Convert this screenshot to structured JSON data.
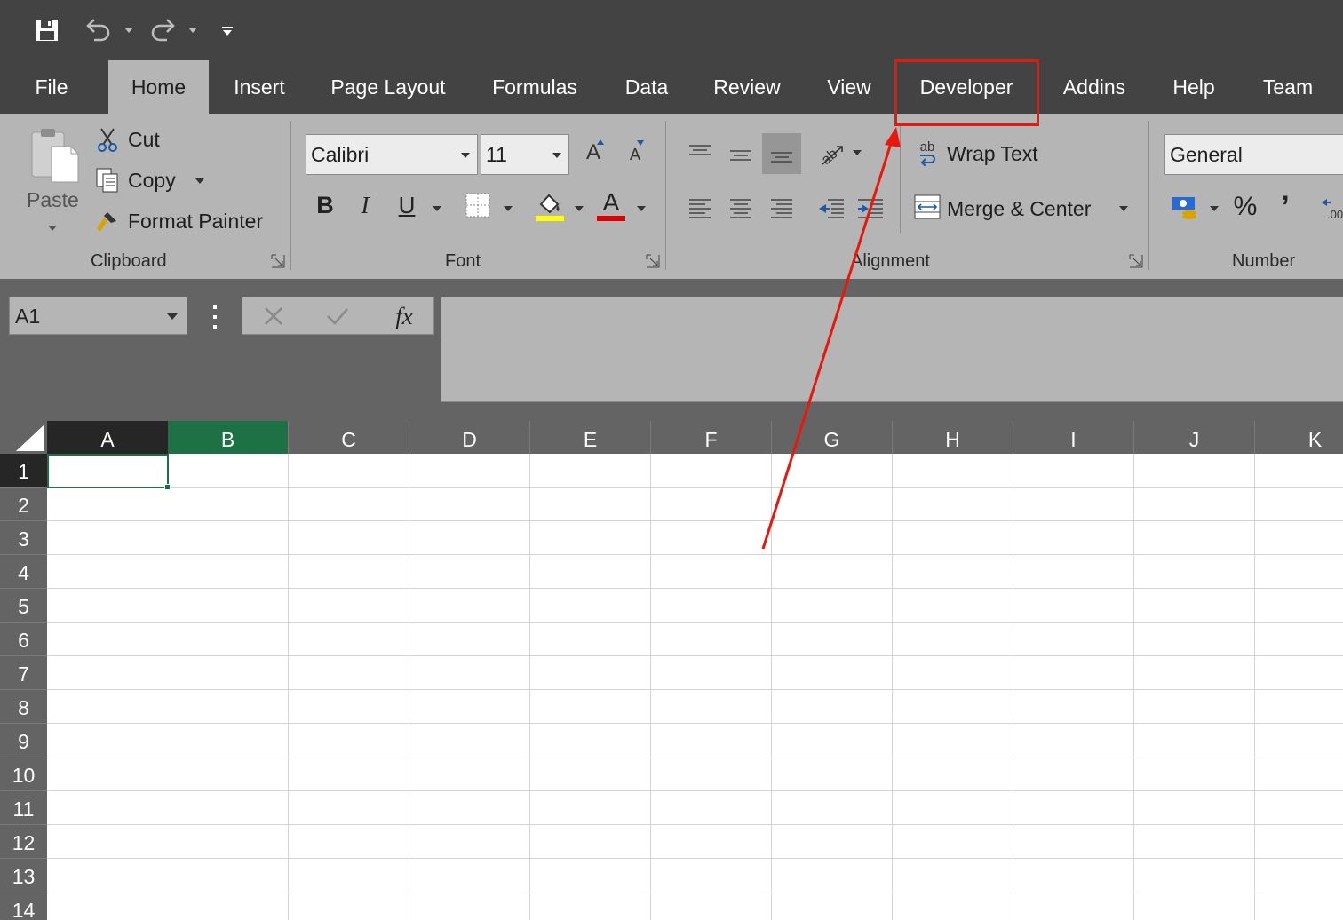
{
  "quick_access": {
    "save_icon": "save-icon",
    "undo_icon": "undo-icon",
    "redo_icon": "redo-icon",
    "customize_icon": "customize-qat-icon"
  },
  "tabs": [
    {
      "label": "File"
    },
    {
      "label": "Home",
      "active": true
    },
    {
      "label": "Insert"
    },
    {
      "label": "Page Layout"
    },
    {
      "label": "Formulas"
    },
    {
      "label": "Data"
    },
    {
      "label": "Review"
    },
    {
      "label": "View"
    },
    {
      "label": "Developer",
      "highlighted": true
    },
    {
      "label": "Addins"
    },
    {
      "label": "Help"
    },
    {
      "label": "Team"
    }
  ],
  "ribbon": {
    "clipboard": {
      "group_label": "Clipboard",
      "paste_label": "Paste",
      "cut_label": "Cut",
      "copy_label": "Copy",
      "format_painter_label": "Format Painter"
    },
    "font": {
      "group_label": "Font",
      "font_name": "Calibri",
      "font_size": "11",
      "bold": "B",
      "italic": "I",
      "underline": "U",
      "font_color_glyph": "A",
      "grow_glyph": "A",
      "shrink_glyph": "A",
      "highlight_color": "#ffff00",
      "font_color": "#e00000"
    },
    "alignment": {
      "group_label": "Alignment",
      "wrap_text_label": "Wrap Text",
      "merge_center_label": "Merge & Center",
      "wrap_glyph": "ab"
    },
    "number": {
      "group_label": "Number",
      "format_value": "General",
      "percent": "%",
      "comma": "’"
    }
  },
  "formula_bar": {
    "name_box": "A1",
    "fx": "fx",
    "formula": ""
  },
  "grid": {
    "columns": [
      "A",
      "B",
      "C",
      "D",
      "E",
      "F",
      "G",
      "H",
      "I",
      "J",
      "K"
    ],
    "rows": [
      "1",
      "2",
      "3",
      "4",
      "5",
      "6",
      "7",
      "8",
      "9",
      "10",
      "11",
      "12",
      "13",
      "14"
    ],
    "active_cell": "A1"
  },
  "colors": {
    "titlebar": "#434343",
    "ribbon": "#b5b5b5",
    "header": "#646464",
    "accent_green": "#1e7145",
    "annotation_red": "#e8180c"
  }
}
